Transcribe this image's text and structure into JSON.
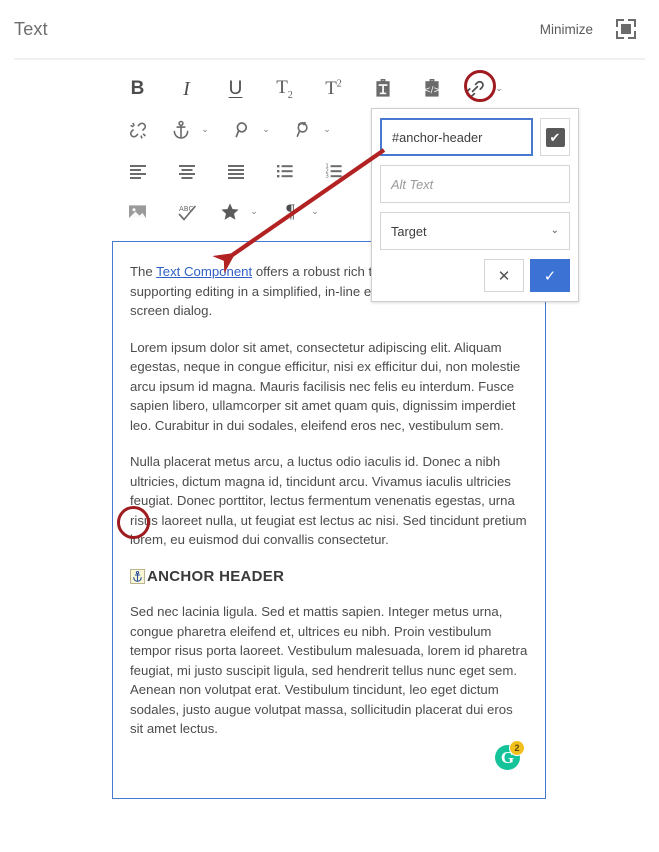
{
  "header": {
    "title": "Text",
    "minimize_label": "Minimize",
    "fullscreen_icon": "fullscreen-icon"
  },
  "toolbar": {
    "rows": [
      [
        {
          "name": "bold-button",
          "label": "B",
          "icon": "bold-icon"
        },
        {
          "name": "italic-button",
          "label": "I",
          "icon": "italic-icon"
        },
        {
          "name": "underline-button",
          "label": "U",
          "icon": "underline-icon"
        },
        {
          "name": "subscript-button",
          "label": "T",
          "icon": "subscript-icon"
        },
        {
          "name": "superscript-button",
          "label": "T",
          "icon": "superscript-icon"
        },
        {
          "name": "paste-as-text-button",
          "label": "",
          "icon": "paste-as-text-icon"
        },
        {
          "name": "paste-from-source-button",
          "label": "",
          "icon": "paste-from-source-icon"
        },
        {
          "name": "link-button",
          "label": "",
          "icon": "link-icon"
        }
      ],
      [
        {
          "name": "unlink-button",
          "label": "",
          "icon": "unlink-icon"
        },
        {
          "name": "anchor-button",
          "label": "",
          "icon": "anchor-icon"
        },
        {
          "name": "find-button",
          "label": "",
          "icon": "search-icon"
        },
        {
          "name": "find-replace-button",
          "label": "",
          "icon": "find-replace-icon"
        }
      ],
      [
        {
          "name": "align-left-button",
          "label": "",
          "icon": "align-left-icon"
        },
        {
          "name": "align-center-button",
          "label": "",
          "icon": "align-center-icon"
        },
        {
          "name": "align-justify-button",
          "label": "",
          "icon": "align-justify-icon"
        },
        {
          "name": "bulleted-list-button",
          "label": "",
          "icon": "bulleted-list-icon"
        },
        {
          "name": "numbered-list-button",
          "label": "",
          "icon": "numbered-list-icon"
        }
      ],
      [
        {
          "name": "insert-image-button",
          "label": "",
          "icon": "image-icon"
        },
        {
          "name": "spellcheck-button",
          "label": "",
          "icon": "spellcheck-icon"
        },
        {
          "name": "special-character-button",
          "label": "",
          "icon": "star-icon"
        },
        {
          "name": "paragraph-format-button",
          "label": "",
          "icon": "pilcrow-icon"
        }
      ]
    ]
  },
  "link_dialog": {
    "url_value": "#anchor-header",
    "url_placeholder": "",
    "checkbox_checked": true,
    "checkbox_glyph": "✔",
    "alt_text_value": "",
    "alt_text_placeholder": "Alt Text",
    "target_label": "Target",
    "cancel_glyph": "✕",
    "confirm_glyph": "✓",
    "accent_color": "#3b72d4",
    "focus_border_color": "#4679cf"
  },
  "editor": {
    "border_color": "#4679cf",
    "link_text": "Text Component",
    "intro_prefix": "The ",
    "intro_suffix": " offers a robust rich text editing experience, supporting editing in a simplified, in-line editor as well as a full-screen dialog.",
    "paragraphs": [
      "Lorem ipsum dolor sit amet, consectetur adipiscing elit. Aliquam egestas, neque in congue efficitur, nisi ex efficitur dui, non molestie arcu ipsum id magna. Mauris facilisis nec felis eu interdum. Fusce sapien libero, ullamcorper sit amet quam quis, dignissim imperdiet leo. Curabitur in dui sodales, eleifend eros nec, vestibulum sem.",
      "Nulla placerat metus arcu, a luctus odio iaculis id. Donec a nibh ultricies, dictum magna id, tincidunt arcu. Vivamus iaculis ultricies feugiat. Donec porttitor, lectus fermentum venenatis egestas, urna risus laoreet nulla, ut feugiat est lectus ac nisi. Sed tincidunt pretium lorem, eu euismod dui convallis consectetur."
    ],
    "anchor_heading": "ANCHOR HEADER",
    "anchor_marker_icon": "anchor-marker-icon",
    "body_after_heading": "Sed nec lacinia ligula. Sed et mattis sapien. Integer metus urna, congue pharetra eleifend et, ultrices eu nibh. Proin vestibulum tempor risus porta laoreet. Vestibulum malesuada, lorem id pharetra feugiat, mi justo suscipit ligula, sed hendrerit tellus nunc eget sem. Aenean non volutpat erat. Vestibulum tincidunt, leo eget dictum sodales, justo augue volutpat massa, sollicitudin placerat dui eros sit amet lectus.",
    "grammarly": {
      "letter": "G",
      "badge_count": "2",
      "brand_color": "#15c39a",
      "badge_color": "#f2c01e"
    }
  },
  "annotations": {
    "circle_color": "#9e1b20",
    "arrow_color": "#b22222"
  }
}
